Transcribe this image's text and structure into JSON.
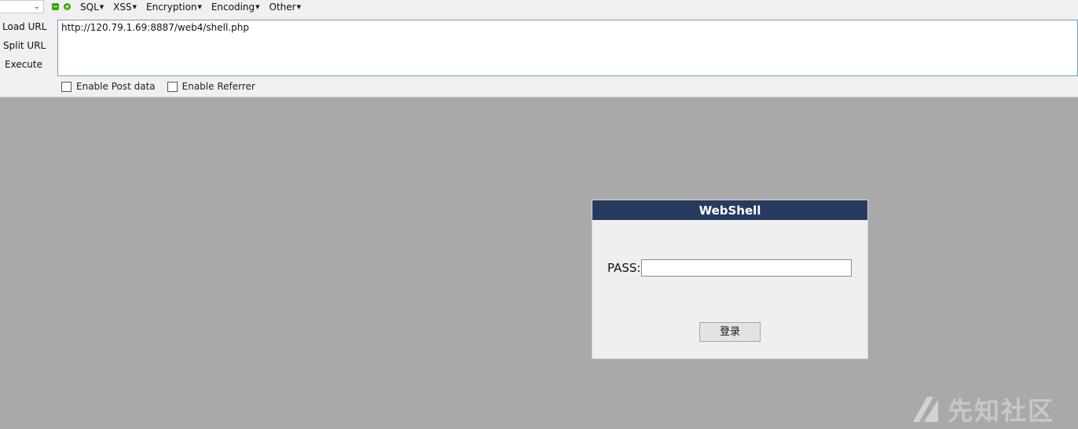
{
  "hackbar": {
    "menus": [
      "SQL",
      "XSS",
      "Encryption",
      "Encoding",
      "Other"
    ],
    "side_buttons": [
      "Load URL",
      "Split URL",
      "Execute"
    ],
    "url_value": "http://120.79.1.69:8887/web4/shell.php",
    "options": [
      "Enable Post data",
      "Enable Referrer"
    ],
    "icons": {
      "remove": "minus-icon",
      "add": "plus-icon",
      "dropdown": "chevron-down-icon"
    }
  },
  "login": {
    "title": "WebShell",
    "pass_label": "PASS:",
    "submit_label": "登录"
  },
  "watermark": {
    "text": "先知社区"
  },
  "colors": {
    "title_bar": "#263b5e",
    "page_bg": "#a9a9a9",
    "toolbar_bg": "#f0f0f0"
  }
}
